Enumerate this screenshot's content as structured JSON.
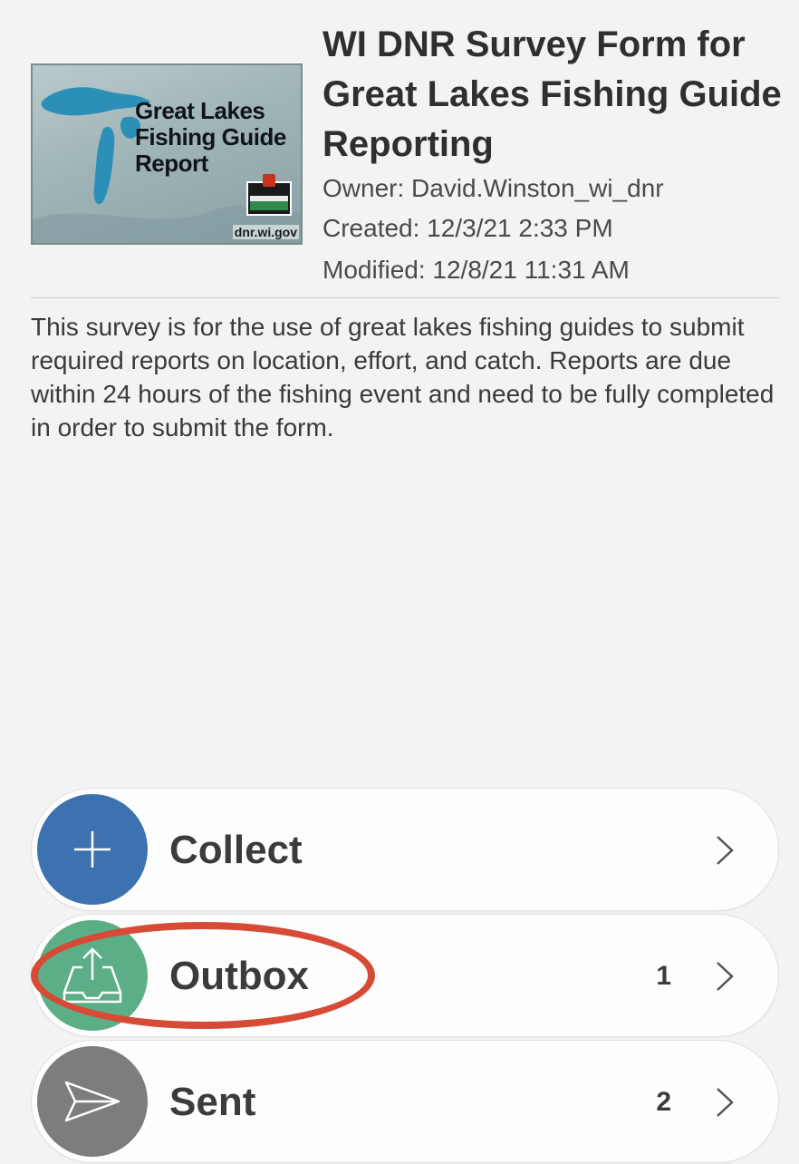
{
  "survey": {
    "thumbnail": {
      "title": "Great Lakes Fishing Guide Report",
      "site": "dnr.wi.gov",
      "icon": "wisconsin-dnr-logo"
    },
    "title": "WI DNR Survey Form for Great Lakes Fishing Guide Reporting",
    "owner": "Owner: David.Winston_wi_dnr",
    "created": "Created: 12/3/21 2:33 PM",
    "modified": "Modified: 12/8/21 11:31 AM",
    "description": "This survey is for the use of great lakes fishing guides to submit required reports on location, effort, and catch. Reports are due within 24 hours of the fishing event and need to be fully completed in order to submit the form."
  },
  "actions": [
    {
      "label": "Collect",
      "count": "",
      "icon": "plus-icon",
      "color": "#3d72b0"
    },
    {
      "label": "Outbox",
      "count": "1",
      "icon": "outbox-upload-icon",
      "color": "#5bae86"
    },
    {
      "label": "Sent",
      "count": "2",
      "icon": "send-icon",
      "color": "#7d7d7d"
    }
  ],
  "annotation": {
    "color": "#d64a36",
    "target": "Outbox"
  }
}
